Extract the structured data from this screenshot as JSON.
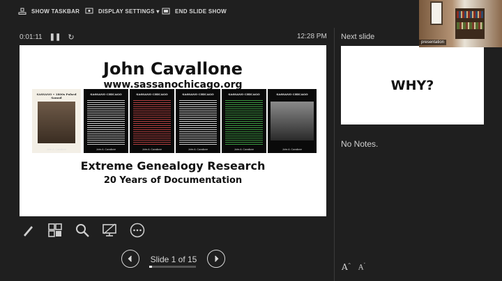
{
  "toolbar": {
    "show_taskbar": "SHOW TASKBAR",
    "display_settings": "DISPLAY SETTINGS ▾",
    "end_slide_show": "END SLIDE SHOW"
  },
  "presenter": {
    "timer": "0:01:11",
    "clock": "12:28 PM",
    "next_slide_label": "Next slide",
    "notes": "No Notes.",
    "slide_counter": "Slide 1 of 15",
    "progress": 0.0667,
    "font_increase": "A",
    "font_decrease": "A"
  },
  "current_slide": {
    "title": "John Cavallone",
    "url": "www.sassanochicago.org",
    "subtitle": "Extreme Genealogy Research",
    "subtitle2": "20 Years of Documentation",
    "covers": [
      {
        "title": "SASSANO • 1800s Pulsed Samod",
        "author": "John A. Cavallone",
        "style": "photo"
      },
      {
        "title": "SASSANO CHICAGO",
        "author": "John A. Cavallone",
        "line_color": "#e8e8e8"
      },
      {
        "title": "SASSANO CHICAGO",
        "author": "John A. Cavallone",
        "line_color": "#d04848"
      },
      {
        "title": "SASSANO CHICAGO",
        "author": "John A. Cavallone",
        "line_color": "#f0f0f0"
      },
      {
        "title": "SASSANO CHICAGO",
        "author": "John A. Cavallone",
        "line_color": "#44b04a"
      },
      {
        "title": "SASSANO CHICAGO",
        "author": "John A. Cavallone",
        "style": "group-photo"
      }
    ]
  },
  "next_slide": {
    "text": "WHY?"
  },
  "webcam": {
    "label": "presentation"
  }
}
